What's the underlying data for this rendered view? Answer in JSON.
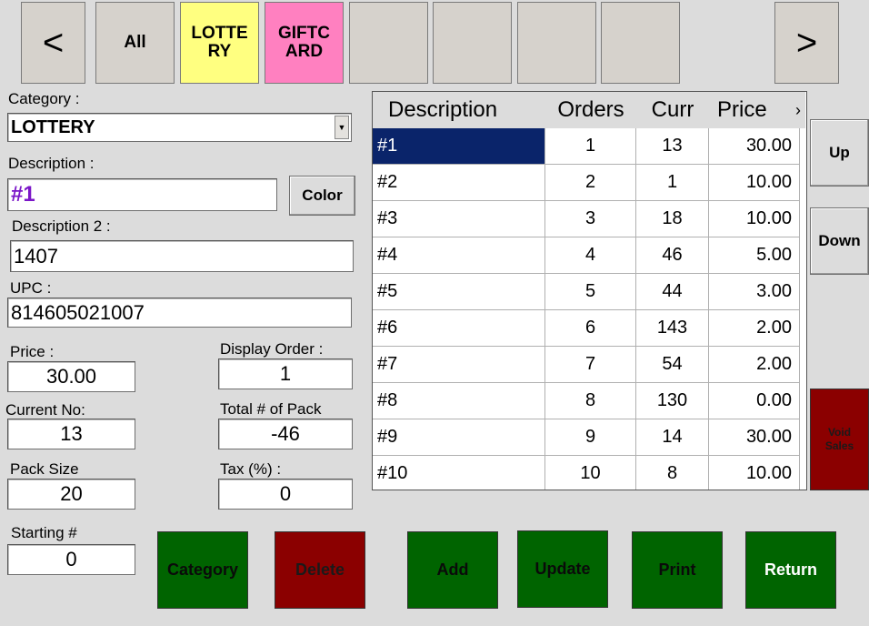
{
  "nav": {
    "prev_label": "<",
    "next_label": ">"
  },
  "categories": [
    {
      "label": "All",
      "style": "all"
    },
    {
      "label": "LOTTE\nRY",
      "style": "lottery"
    },
    {
      "label": "GIFTC\nARD",
      "style": "gift"
    },
    {
      "label": "",
      "style": "empty"
    },
    {
      "label": "",
      "style": "empty"
    },
    {
      "label": "",
      "style": "empty"
    },
    {
      "label": "",
      "style": "empty"
    }
  ],
  "form": {
    "category_label": "Category :",
    "category_value": "LOTTERY",
    "description_label": "Description :",
    "description_value": "#1",
    "color_button": "Color",
    "description2_label": "Description 2 :",
    "description2_value": "1407",
    "upc_label": "UPC :",
    "upc_value": "814605021007",
    "price_label": "Price :",
    "price_value": "30.00",
    "display_order_label": "Display Order :",
    "display_order_value": "1",
    "current_no_label": "Current No:",
    "current_no_value": "13",
    "total_pack_label": "Total # of Pack",
    "total_pack_value": "-46",
    "pack_size_label": "Pack Size",
    "pack_size_value": "20",
    "tax_label": "Tax (%) :",
    "tax_value": "0",
    "starting_label": "Starting #",
    "starting_value": "0"
  },
  "grid": {
    "headers": [
      "Description",
      "Orders",
      "Curr",
      "Price"
    ],
    "more_indicator": "›",
    "rows": [
      [
        "#1",
        "1",
        "13",
        "30.00"
      ],
      [
        "#2",
        "2",
        "1",
        "10.00"
      ],
      [
        "#3",
        "3",
        "18",
        "10.00"
      ],
      [
        "#4",
        "4",
        "46",
        "5.00"
      ],
      [
        "#5",
        "5",
        "44",
        "3.00"
      ],
      [
        "#6",
        "6",
        "143",
        "2.00"
      ],
      [
        "#7",
        "7",
        "54",
        "2.00"
      ],
      [
        "#8",
        "8",
        "130",
        "0.00"
      ],
      [
        "#9",
        "9",
        "14",
        "30.00"
      ],
      [
        "#10",
        "10",
        "8",
        "10.00"
      ]
    ],
    "selected_row": 0
  },
  "side": {
    "up": "Up",
    "down": "Down",
    "void_sales": "Void\nSales"
  },
  "actions": {
    "category": "Category",
    "delete": "Delete",
    "add": "Add",
    "update": "Update",
    "print": "Print",
    "return": "Return"
  },
  "colors": {
    "lottery": "#ffff80",
    "giftcard": "#ff80c0",
    "action_green": "#006400",
    "action_red": "#8b0000",
    "selection": "#0a246a",
    "description_text": "#7b16c8"
  }
}
